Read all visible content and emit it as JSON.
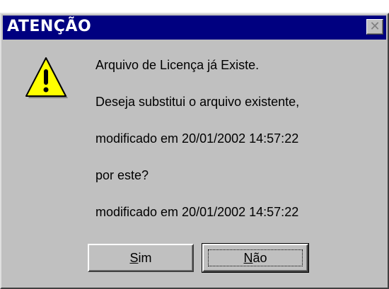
{
  "window": {
    "title": "ATENÇÃO",
    "close_glyph": "✕"
  },
  "icon": "warning-icon",
  "message_lines": [
    "Arquivo de Licença já Existe.",
    "Deseja substitui o arquivo existente,",
    "modificado em 20/01/2002 14:57:22",
    "por este?",
    "modificado em 20/01/2002 14:57:22"
  ],
  "buttons": {
    "yes": {
      "mnemonic": "S",
      "rest": "im"
    },
    "no": {
      "mnemonic": "N",
      "rest": "ão"
    }
  },
  "colors": {
    "titlebar": "#000080",
    "dialog_bg": "#c0c0c0",
    "warning_fill": "#ffff00"
  }
}
